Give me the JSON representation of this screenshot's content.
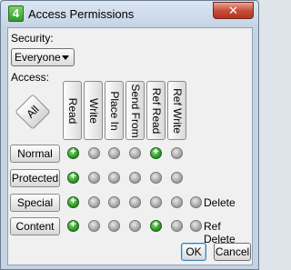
{
  "window": {
    "title": "Access Permissions",
    "icon_glyph": "4",
    "close_glyph": "✕"
  },
  "security": {
    "label": "Security:",
    "selected": "Everyone"
  },
  "access": {
    "label": "Access:",
    "all_label": "All"
  },
  "columns": [
    "Read",
    "Write",
    "Place In",
    "Send From",
    "Ref Read",
    "Ref Write"
  ],
  "rows": [
    {
      "label": "Normal",
      "states": [
        true,
        false,
        false,
        false,
        true,
        false
      ],
      "extra": null
    },
    {
      "label": "Protected",
      "states": [
        true,
        false,
        false,
        false,
        false,
        false
      ],
      "extra": null
    },
    {
      "label": "Special",
      "states": [
        true,
        false,
        false,
        false,
        false,
        false
      ],
      "extra": "Delete"
    },
    {
      "label": "Content",
      "states": [
        true,
        false,
        false,
        false,
        true,
        false
      ],
      "extra": "Ref Delete"
    }
  ],
  "buttons": {
    "ok": "OK",
    "cancel": "Cancel"
  },
  "colors": {
    "on": "#2f9a27",
    "off": "#a6a6a6"
  }
}
